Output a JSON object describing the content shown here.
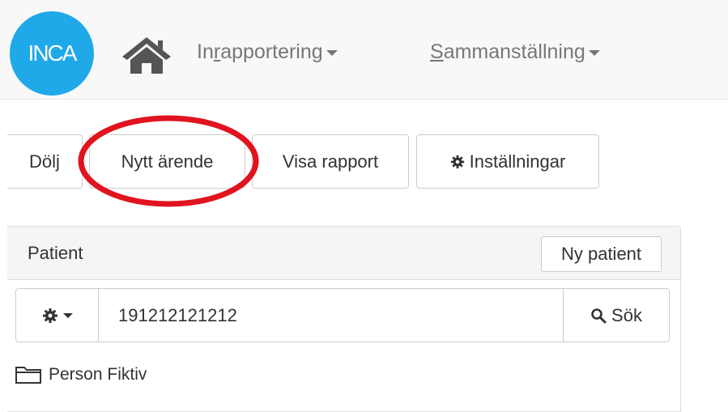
{
  "navbar": {
    "logo_text": "INCA",
    "logo_color": "#1fa9e8",
    "home_icon": "home-icon",
    "menu": [
      {
        "label_pre": "In",
        "label_underlined": "r",
        "label_post": "apportering"
      },
      {
        "label_pre": "",
        "label_underlined": "S",
        "label_post": "ammanställning"
      }
    ]
  },
  "toolbar": {
    "dolj_label": "Dölj",
    "nytt_label": "Nytt ärende",
    "visa_label": "Visa rapport",
    "installningar_label": "Inställningar",
    "installningar_icon": "gear-icon",
    "highlight_color": "#e0141e"
  },
  "patient_panel": {
    "title": "Patient",
    "new_patient_label": "Ny patient",
    "settings_icon": "gear-icon",
    "search_value": "191212121212",
    "search_button_label": "Sök",
    "search_icon": "search-icon",
    "results": [
      {
        "icon": "folder-icon",
        "label": "Person Fiktiv"
      }
    ]
  }
}
